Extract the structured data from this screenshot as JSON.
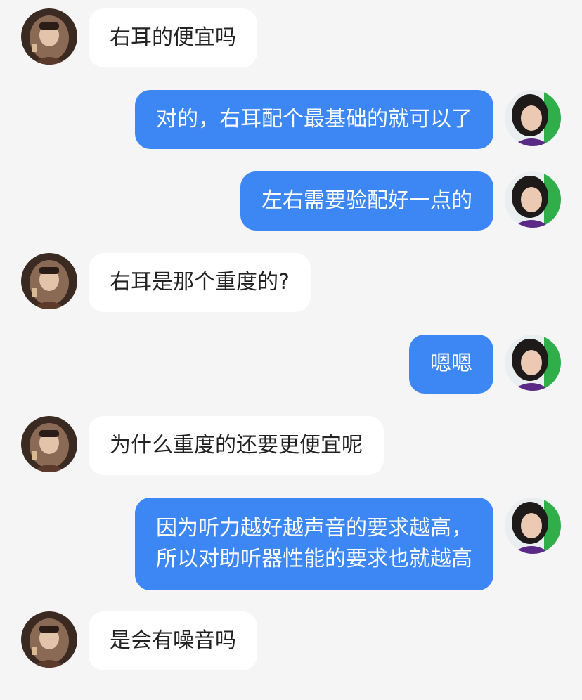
{
  "colors": {
    "background": "#f5f5f5",
    "incoming_bubble": "#ffffff",
    "outgoing_bubble": "#3d87f5",
    "incoming_text": "#222222",
    "outgoing_text": "#ffffff"
  },
  "messages": [
    {
      "sender": "other",
      "lines": [
        "右耳的便宜吗"
      ]
    },
    {
      "sender": "self",
      "lines": [
        "对的，右耳配个最基础的就可以了"
      ]
    },
    {
      "sender": "self",
      "lines": [
        "左右需要验配好一点的"
      ]
    },
    {
      "sender": "other",
      "lines": [
        "右耳是那个重度的?"
      ]
    },
    {
      "sender": "self",
      "lines": [
        "嗯嗯"
      ]
    },
    {
      "sender": "other",
      "lines": [
        "为什么重度的还要更便宜呢"
      ]
    },
    {
      "sender": "self",
      "lines": [
        "因为听力越好越声音的要求越高，",
        "所以对助听器性能的要求也就越高"
      ]
    },
    {
      "sender": "other",
      "lines": [
        "是会有噪音吗"
      ]
    }
  ]
}
